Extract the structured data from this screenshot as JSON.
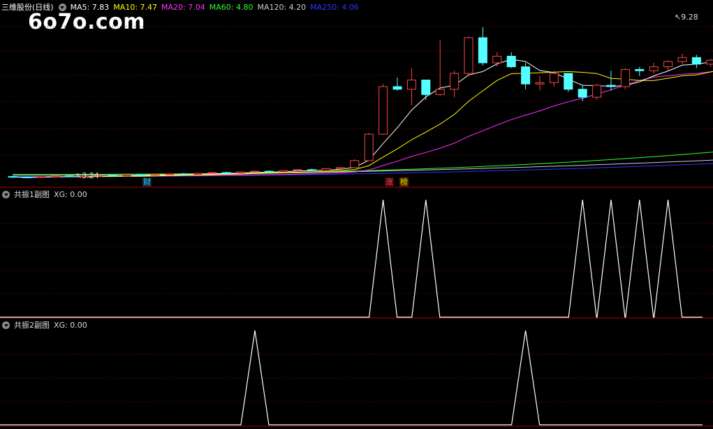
{
  "watermark": "6o7o.com",
  "main": {
    "title": "三维股份(日线)",
    "ma": [
      {
        "label": "MA5: 7.83",
        "color": "#ffffff"
      },
      {
        "label": "MA10: 7.47",
        "color": "#ffff00"
      },
      {
        "label": "MA20: 7.04",
        "color": "#ff33ff"
      },
      {
        "label": "MA60: 4.80",
        "color": "#33ff33"
      },
      {
        "label": "MA120: 4.20",
        "color": "#cccccc"
      },
      {
        "label": "MA250: 4.06",
        "color": "#3333ff"
      }
    ],
    "high_label": "9.28",
    "low_label": "3.24",
    "badges": [
      {
        "text": "财",
        "color": "#33ccff",
        "bg": "#0a2a3a"
      },
      {
        "text": "涨",
        "color": "#ff4444",
        "bg": "#3a0a0a"
      },
      {
        "text": "榜",
        "color": "#ffcc00",
        "bg": "#3a2a00"
      }
    ]
  },
  "sub1": {
    "title": "共振1副图",
    "value": "XG: 0.00"
  },
  "sub2": {
    "title": "共振2副图",
    "value": "XG: 0.00"
  },
  "colors": {
    "up": "#ff4444",
    "down": "#54ffff",
    "grid": "#8b0000",
    "border": "#b00000"
  },
  "chart_data": [
    {
      "type": "candlestick",
      "title": "三维股份(日线)",
      "ylim": [
        3.0,
        9.5
      ],
      "candles": [
        [
          3.3,
          3.32,
          3.25,
          3.28
        ],
        [
          3.28,
          3.3,
          3.24,
          3.26
        ],
        [
          3.27,
          3.31,
          3.24,
          3.29
        ],
        [
          3.29,
          3.34,
          3.27,
          3.32
        ],
        [
          3.32,
          3.35,
          3.28,
          3.3
        ],
        [
          3.3,
          3.33,
          3.27,
          3.31
        ],
        [
          3.31,
          3.36,
          3.29,
          3.34
        ],
        [
          3.34,
          3.37,
          3.3,
          3.32
        ],
        [
          3.32,
          3.38,
          3.31,
          3.36
        ],
        [
          3.36,
          3.4,
          3.33,
          3.35
        ],
        [
          3.35,
          3.39,
          3.32,
          3.37
        ],
        [
          3.37,
          3.42,
          3.35,
          3.4
        ],
        [
          3.4,
          3.44,
          3.37,
          3.38
        ],
        [
          3.38,
          3.43,
          3.36,
          3.42
        ],
        [
          3.42,
          3.47,
          3.4,
          3.45
        ],
        [
          3.45,
          3.48,
          3.41,
          3.43
        ],
        [
          3.43,
          3.49,
          3.42,
          3.47
        ],
        [
          3.47,
          3.52,
          3.45,
          3.5
        ],
        [
          3.5,
          3.53,
          3.46,
          3.48
        ],
        [
          3.48,
          3.55,
          3.47,
          3.53
        ],
        [
          3.53,
          3.58,
          3.5,
          3.56
        ],
        [
          3.56,
          3.6,
          3.52,
          3.54
        ],
        [
          3.54,
          3.62,
          3.53,
          3.6
        ],
        [
          3.6,
          3.66,
          3.58,
          3.64
        ],
        [
          3.64,
          3.95,
          3.62,
          3.9
        ],
        [
          3.9,
          4.95,
          3.88,
          4.9
        ],
        [
          4.9,
          6.8,
          4.88,
          6.7
        ],
        [
          6.7,
          7.05,
          6.55,
          6.6
        ],
        [
          6.6,
          7.4,
          6.0,
          6.95
        ],
        [
          6.95,
          6.7,
          6.2,
          6.4
        ],
        [
          6.4,
          8.45,
          6.35,
          6.6
        ],
        [
          6.6,
          7.3,
          6.3,
          7.2
        ],
        [
          7.2,
          8.6,
          7.1,
          8.55
        ],
        [
          8.55,
          8.95,
          7.5,
          7.6
        ],
        [
          7.6,
          8.0,
          7.45,
          7.85
        ],
        [
          7.85,
          8.0,
          7.4,
          7.45
        ],
        [
          7.45,
          7.6,
          6.6,
          6.8
        ],
        [
          6.8,
          7.1,
          6.55,
          6.85
        ],
        [
          6.85,
          7.3,
          6.7,
          7.2
        ],
        [
          7.2,
          7.0,
          6.5,
          6.6
        ],
        [
          6.6,
          6.75,
          6.15,
          6.3
        ],
        [
          6.3,
          6.8,
          6.2,
          6.75
        ],
        [
          6.75,
          7.3,
          6.55,
          6.7
        ],
        [
          6.7,
          7.4,
          6.6,
          7.35
        ],
        [
          7.35,
          7.45,
          7.1,
          7.3
        ],
        [
          7.3,
          7.6,
          7.2,
          7.45
        ],
        [
          7.45,
          7.7,
          7.3,
          7.65
        ],
        [
          7.65,
          7.95,
          7.55,
          7.8
        ],
        [
          7.8,
          7.9,
          7.4,
          7.55
        ],
        [
          7.55,
          7.75,
          7.45,
          7.7
        ],
        [
          7.7,
          7.85,
          7.55,
          7.75
        ],
        [
          7.75,
          7.95,
          7.65,
          7.85
        ],
        [
          7.85,
          8.0,
          7.7,
          7.95
        ],
        [
          7.95,
          8.1,
          7.8,
          8.05
        ],
        [
          8.05,
          8.15,
          7.85,
          7.95
        ],
        [
          7.95,
          8.25,
          7.85,
          8.2
        ],
        [
          8.2,
          8.55,
          8.1,
          8.45
        ],
        [
          8.45,
          8.5,
          8.4,
          8.45
        ],
        [
          8.45,
          9.1,
          8.4,
          8.95
        ],
        [
          8.95,
          9.28,
          7.1,
          7.85
        ],
        [
          7.8,
          8.25,
          7.55,
          8.2
        ]
      ],
      "ma_values": {
        "MA5": 7.83,
        "MA10": 7.47,
        "MA20": 7.04,
        "MA60": 4.8,
        "MA120": 4.2,
        "MA250": 4.06
      }
    },
    {
      "type": "line",
      "title": "共振1副图",
      "ylim": [
        0,
        1
      ],
      "spikes": [
        26,
        29,
        40,
        42,
        44,
        46
      ]
    },
    {
      "type": "line",
      "title": "共振2副图",
      "ylim": [
        0,
        1
      ],
      "spikes": [
        17,
        36
      ]
    }
  ]
}
